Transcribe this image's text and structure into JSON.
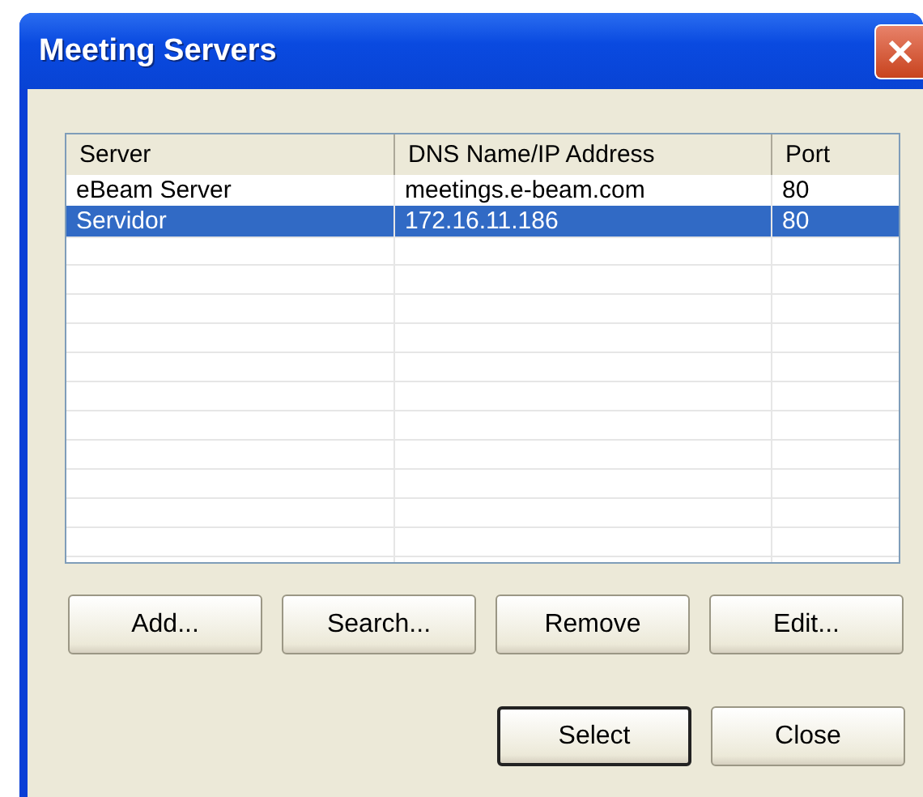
{
  "window": {
    "title": "Meeting Servers"
  },
  "table": {
    "columns": [
      "Server",
      "DNS Name/IP Address",
      "Port"
    ],
    "rows": [
      {
        "cells": [
          "eBeam Server",
          "meetings.e-beam.com",
          "80"
        ],
        "selected": false
      },
      {
        "cells": [
          "Servidor",
          "172.16.11.186",
          "80"
        ],
        "selected": true
      }
    ]
  },
  "list_buttons": [
    {
      "label": "Add..."
    },
    {
      "label": "Search..."
    },
    {
      "label": "Remove"
    },
    {
      "label": "Edit..."
    }
  ],
  "dialog_buttons": [
    {
      "label": "Select",
      "default": true
    },
    {
      "label": "Close",
      "default": false
    }
  ]
}
